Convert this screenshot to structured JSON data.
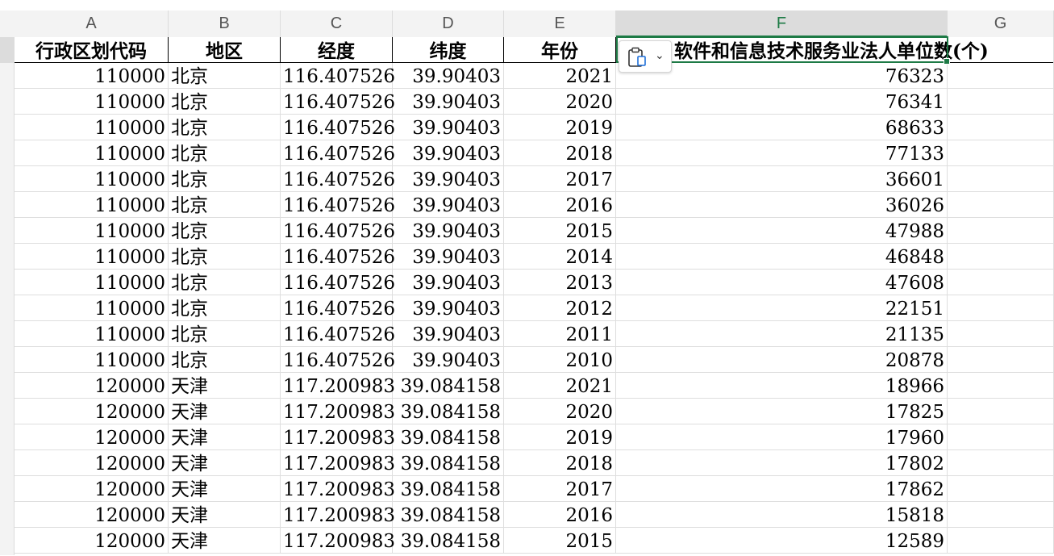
{
  "column_headers": [
    "A",
    "B",
    "C",
    "D",
    "E",
    "F",
    "G"
  ],
  "selected_column": "F",
  "table": {
    "headers": [
      "行政区划代码",
      "地区",
      "经度",
      "纬度",
      "年份",
      "软件和信息技术服务业法人单位数(个)"
    ],
    "rows": [
      [
        "110000",
        "北京",
        "116.407526",
        "39.90403",
        "2021",
        "76323"
      ],
      [
        "110000",
        "北京",
        "116.407526",
        "39.90403",
        "2020",
        "76341"
      ],
      [
        "110000",
        "北京",
        "116.407526",
        "39.90403",
        "2019",
        "68633"
      ],
      [
        "110000",
        "北京",
        "116.407526",
        "39.90403",
        "2018",
        "77133"
      ],
      [
        "110000",
        "北京",
        "116.407526",
        "39.90403",
        "2017",
        "36601"
      ],
      [
        "110000",
        "北京",
        "116.407526",
        "39.90403",
        "2016",
        "36026"
      ],
      [
        "110000",
        "北京",
        "116.407526",
        "39.90403",
        "2015",
        "47988"
      ],
      [
        "110000",
        "北京",
        "116.407526",
        "39.90403",
        "2014",
        "46848"
      ],
      [
        "110000",
        "北京",
        "116.407526",
        "39.90403",
        "2013",
        "47608"
      ],
      [
        "110000",
        "北京",
        "116.407526",
        "39.90403",
        "2012",
        "22151"
      ],
      [
        "110000",
        "北京",
        "116.407526",
        "39.90403",
        "2011",
        "21135"
      ],
      [
        "110000",
        "北京",
        "116.407526",
        "39.90403",
        "2010",
        "20878"
      ],
      [
        "120000",
        "天津",
        "117.200983",
        "39.084158",
        "2021",
        "18966"
      ],
      [
        "120000",
        "天津",
        "117.200983",
        "39.084158",
        "2020",
        "17825"
      ],
      [
        "120000",
        "天津",
        "117.200983",
        "39.084158",
        "2019",
        "17960"
      ],
      [
        "120000",
        "天津",
        "117.200983",
        "39.084158",
        "2018",
        "17802"
      ],
      [
        "120000",
        "天津",
        "117.200983",
        "39.084158",
        "2017",
        "17862"
      ],
      [
        "120000",
        "天津",
        "117.200983",
        "39.084158",
        "2016",
        "15818"
      ],
      [
        "120000",
        "天津",
        "117.200983",
        "39.084158",
        "2015",
        "12589"
      ]
    ]
  },
  "paste_options_icon": "clipboard-paste-icon",
  "colors": {
    "selection": "#1d7a45",
    "header_bg": "#f3f3f3"
  }
}
